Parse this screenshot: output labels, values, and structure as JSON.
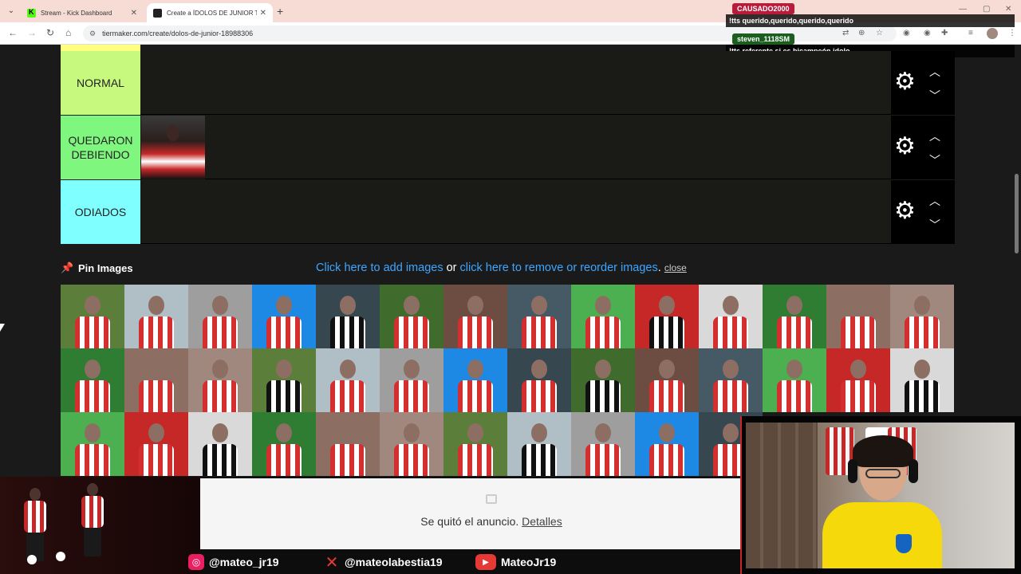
{
  "browser": {
    "tabs": [
      {
        "title": "Stream - Kick Dashboard",
        "favicon": "kick-icon"
      },
      {
        "title": "Create a ÍDOLOS DE JUNIOR Tier List",
        "favicon": "tiermaker-icon",
        "active": true
      }
    ],
    "url": "tiermaker.com/create/dolos-de-junior-18988306"
  },
  "chat": [
    {
      "user": "CAUSADO2000",
      "message": "!tts querido,querido,querido,querido",
      "color": "#b71c3b"
    },
    {
      "user": "steven_1118SM",
      "message": "!tts referente si es bicampeón idolo",
      "color": "#1b5e20"
    }
  ],
  "tiers": [
    {
      "label": "NORMAL",
      "color": "#c8f97f",
      "items": []
    },
    {
      "label": "QUEDARON DEBIENDO",
      "color": "#7ff77f",
      "items": [
        "player-1"
      ]
    },
    {
      "label": "ODIADOS",
      "color": "#7fffff",
      "items": []
    }
  ],
  "top_tier_color": "#ffff7f",
  "pin_bar": {
    "label": "Pin Images",
    "link_add": "Click here to add images",
    "or": " or ",
    "link_remove": "click here to remove or reorder images",
    "period": ". ",
    "close": "close"
  },
  "image_pool": {
    "rows": 3,
    "columns": 14,
    "count_visible": 39
  },
  "ad": {
    "text": "Se quitó el anuncio. ",
    "details": "Detalles"
  },
  "socials": [
    {
      "platform": "instagram-icon",
      "handle": "@mateo_jr19"
    },
    {
      "platform": "x-icon",
      "handle": "@mateolabestia19"
    },
    {
      "platform": "youtube-icon",
      "handle": "MateoJr19"
    }
  ]
}
